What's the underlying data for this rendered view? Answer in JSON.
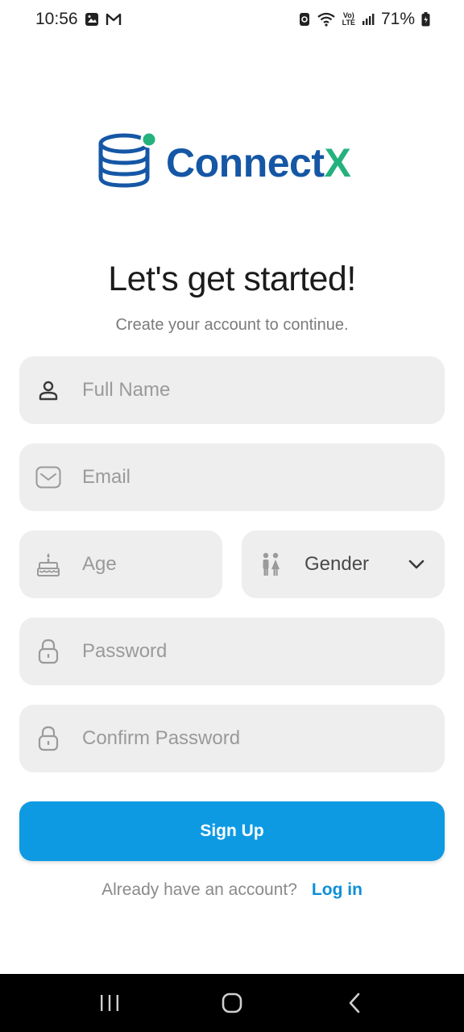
{
  "status_bar": {
    "time": "10:56",
    "battery": "71%",
    "network_top": "Vo)",
    "network_bottom": "LTE",
    "icons": [
      "image-icon",
      "gmail-icon",
      "data-saver-icon",
      "wifi-icon",
      "volte-icon",
      "signal-icon",
      "battery-icon"
    ]
  },
  "logo": {
    "text_main": "Connect",
    "text_accent": "X",
    "colors": {
      "primary": "#1557a5",
      "accent": "#24b17d"
    }
  },
  "header": {
    "title": "Let's get started!",
    "subtitle": "Create your account to continue."
  },
  "form": {
    "full_name": {
      "placeholder": "Full Name",
      "icon": "person-icon"
    },
    "email": {
      "placeholder": "Email",
      "icon": "envelope-icon"
    },
    "age": {
      "placeholder": "Age",
      "icon": "cake-icon"
    },
    "gender": {
      "value": "Gender",
      "icon": "people-icon"
    },
    "password": {
      "placeholder": "Password",
      "icon": "lock-icon"
    },
    "confirm_password": {
      "placeholder": "Confirm Password",
      "icon": "lock-icon"
    }
  },
  "actions": {
    "signup_label": "Sign Up",
    "login_prompt": "Already have an account?",
    "login_label": "Log in",
    "button_color": "#0d9ae3"
  },
  "nav": {
    "icons": [
      "recent-apps-icon",
      "home-icon",
      "back-icon"
    ]
  }
}
